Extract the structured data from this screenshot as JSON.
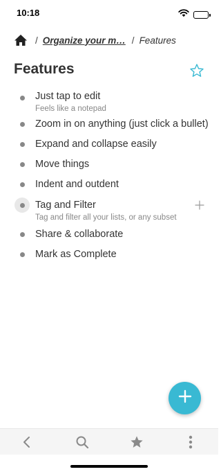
{
  "status_bar": {
    "time": "10:18",
    "icons": [
      "wifi-icon",
      "battery-icon"
    ]
  },
  "breadcrumb": {
    "home_icon": "home-icon",
    "separator": "/",
    "parent": "Organize your m…",
    "current": "Features"
  },
  "page": {
    "title": "Features",
    "star_icon": "star-outline-icon"
  },
  "items": [
    {
      "text": "Just tap to edit",
      "note": "Feels like a notepad"
    },
    {
      "text": "Zoom in on anything (just click a bullet)"
    },
    {
      "text": "Expand and collapse easily"
    },
    {
      "text": "Move things"
    },
    {
      "text": "Indent and outdent"
    },
    {
      "text": "Tag and Filter",
      "note": "Tag and filter all your lists, or any subset"
    },
    {
      "text": "Share & collaborate"
    },
    {
      "text": "Mark as Complete"
    }
  ],
  "fab": {
    "icon": "plus-icon"
  },
  "toolbar": {
    "icons": [
      "back-chevron-icon",
      "search-icon",
      "star-icon",
      "more-vertical-icon"
    ]
  },
  "colors": {
    "accent": "#39b9d3",
    "text": "#333333",
    "note": "#888888",
    "bullet": "#888888",
    "toolbar_bg": "#f5f5f5",
    "toolbar_icon": "#8a8a8a"
  }
}
